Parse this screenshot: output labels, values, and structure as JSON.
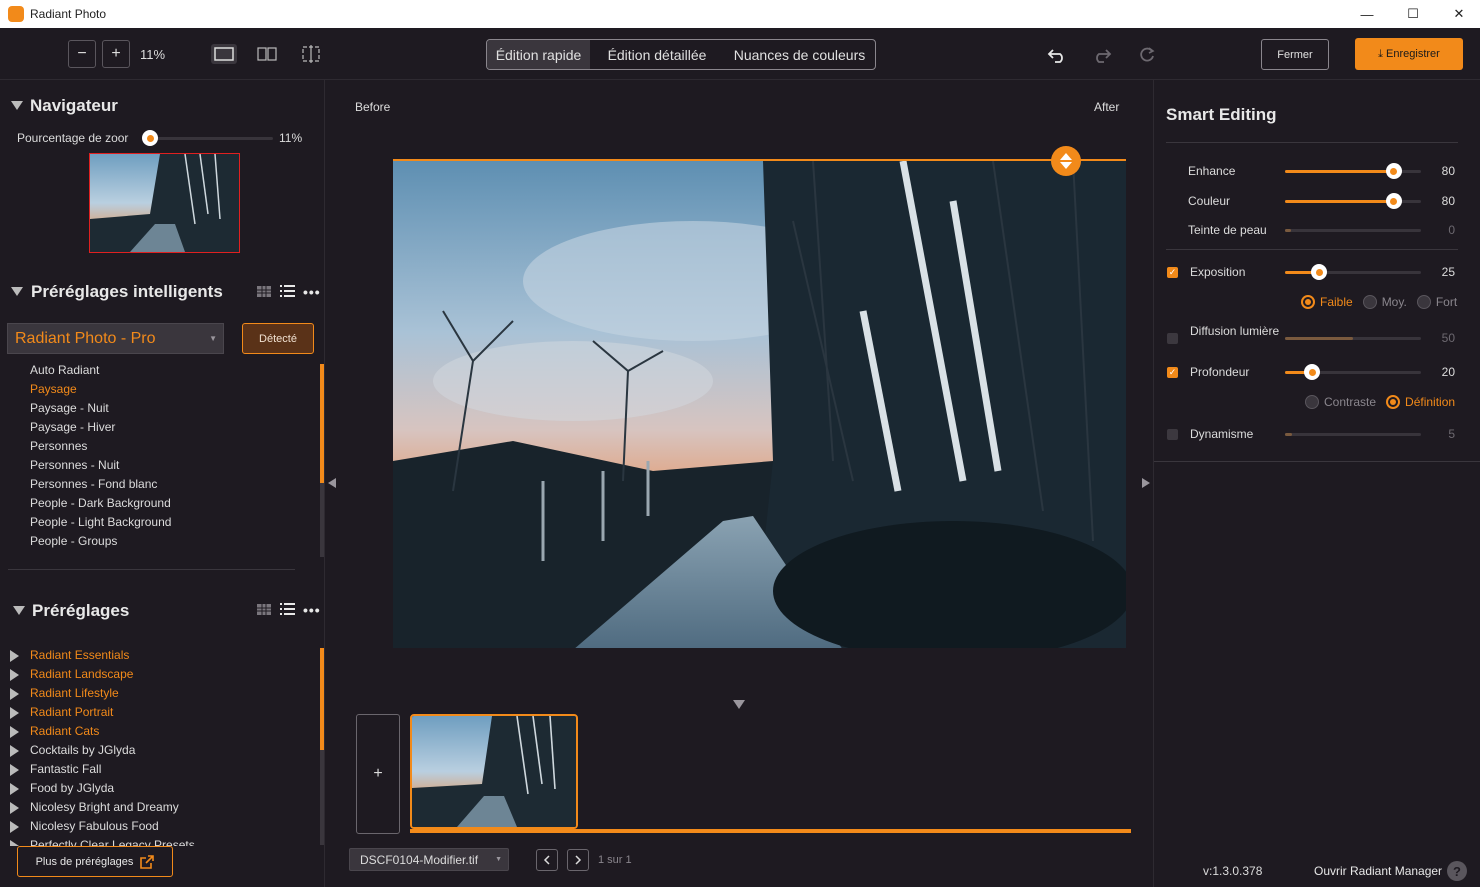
{
  "window": {
    "title": "Radiant Photo",
    "controls": {
      "minimize": "—",
      "maximize": "☐",
      "close": "✕"
    }
  },
  "toolbar": {
    "zoom_out": "−",
    "zoom_in": "+",
    "zoom_percent": "11%",
    "modes": [
      "Édition rapide",
      "Édition détaillée",
      "Nuances de couleurs"
    ],
    "active_mode": "Édition rapide",
    "close_label": "Fermer",
    "save_label": "Enregistrer"
  },
  "navigator": {
    "title": "Navigateur",
    "zoom_label": "Pourcentage de zoor",
    "zoom_value": "11%",
    "zoom_level": 0.0
  },
  "smart_presets": {
    "title": "Préréglages intelligents",
    "dropdown_value": "Radiant Photo - Pro",
    "detected_label": "Détecté",
    "items": [
      {
        "label": "Auto Radiant",
        "selected": false
      },
      {
        "label": "Paysage",
        "selected": true
      },
      {
        "label": "Paysage - Nuit",
        "selected": false
      },
      {
        "label": "Paysage - Hiver",
        "selected": false
      },
      {
        "label": "Personnes",
        "selected": false
      },
      {
        "label": "Personnes - Nuit",
        "selected": false
      },
      {
        "label": "Personnes - Fond blanc",
        "selected": false
      },
      {
        "label": "People - Dark Background",
        "selected": false
      },
      {
        "label": "People - Light Background",
        "selected": false
      },
      {
        "label": "People - Groups",
        "selected": false
      }
    ]
  },
  "presets": {
    "title": "Préréglages",
    "items": [
      {
        "label": "Radiant Essentials",
        "highlight": true
      },
      {
        "label": "Radiant Landscape",
        "highlight": true
      },
      {
        "label": "Radiant Lifestyle",
        "highlight": true
      },
      {
        "label": "Radiant Portrait",
        "highlight": true
      },
      {
        "label": "Radiant Cats",
        "highlight": true
      },
      {
        "label": "Cocktails by JGlyda",
        "highlight": false
      },
      {
        "label": "Fantastic Fall",
        "highlight": false
      },
      {
        "label": "Food by JGlyda",
        "highlight": false
      },
      {
        "label": "Nicolesy Bright and Dreamy",
        "highlight": false
      },
      {
        "label": "Nicolesy Fabulous Food",
        "highlight": false
      },
      {
        "label": "Perfectly Clear Legacy Presets",
        "highlight": false
      }
    ],
    "more_label": "Plus de préréglages"
  },
  "viewer": {
    "before_label": "Before",
    "after_label": "After",
    "add_label": "+",
    "file_name": "DSCF0104-Modifier.tif",
    "page_info": "1 sur 1"
  },
  "smart_editing": {
    "title": "Smart Editing",
    "sliders": [
      {
        "label": "Enhance",
        "value": 80,
        "max": 100,
        "checkbox": null,
        "dim": false
      },
      {
        "label": "Couleur",
        "value": 80,
        "max": 100,
        "checkbox": null,
        "dim": false
      },
      {
        "label": "Teinte de peau",
        "value": 0,
        "max": 100,
        "checkbox": null,
        "dim": true
      },
      {
        "label": "Exposition",
        "value": 25,
        "max": 100,
        "checkbox": true,
        "dim": false
      },
      {
        "label": "Diffusion lumière",
        "value": 50,
        "max": 100,
        "checkbox": false,
        "dim": true
      },
      {
        "label": "Profondeur",
        "value": 20,
        "max": 100,
        "checkbox": true,
        "dim": false
      },
      {
        "label": "Dynamisme",
        "value": 5,
        "max": 100,
        "checkbox": false,
        "dim": true
      }
    ],
    "exposure_options": [
      "Faible",
      "Moy.",
      "Fort"
    ],
    "exposure_selected": "Faible",
    "depth_options": [
      "Contraste",
      "Définition"
    ],
    "depth_selected": "Définition"
  },
  "footer": {
    "version": "v:1.3.0.378",
    "manager_label": "Ouvrir Radiant Manager",
    "help": "?"
  },
  "colors": {
    "accent": "#f28a1a",
    "background": "#1e1a21"
  }
}
